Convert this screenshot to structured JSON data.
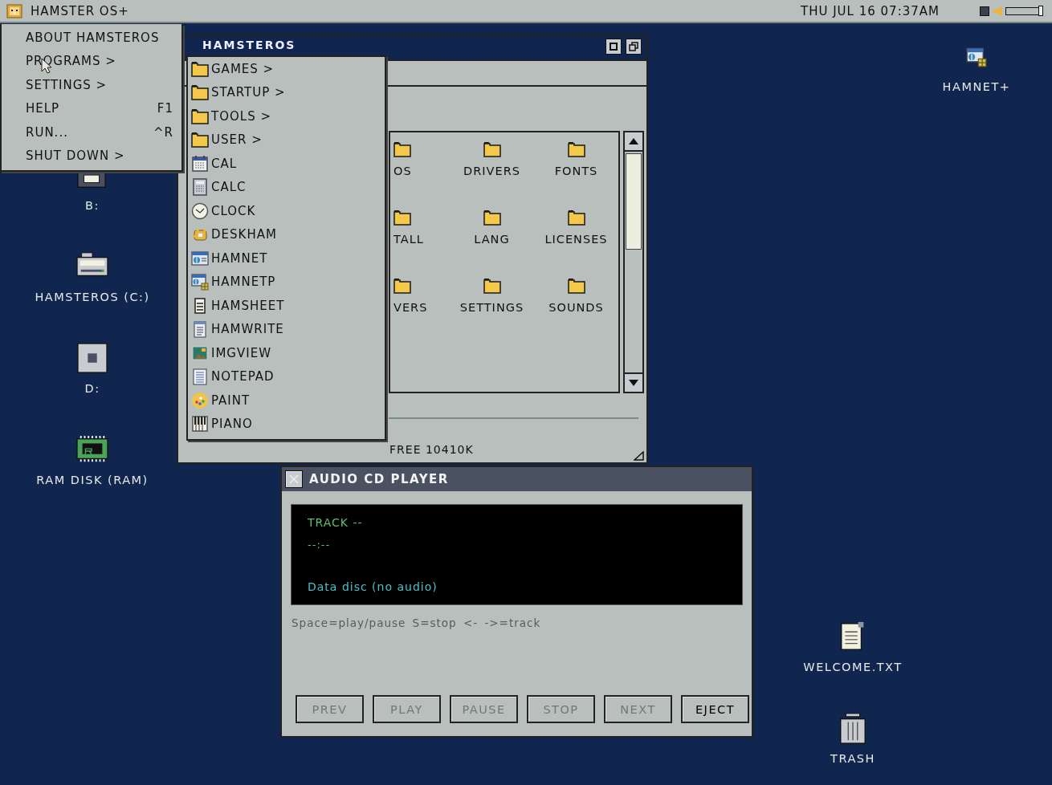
{
  "menubar": {
    "title": "HAMSTER OS+",
    "clock": "THU JUL 16 07:37AM",
    "volume": {
      "level": 0.97
    }
  },
  "start_menu": {
    "items": [
      {
        "label": "ABOUT HAMSTEROS"
      },
      {
        "label": "PROGRAMS >"
      },
      {
        "label": "SETTINGS >"
      },
      {
        "label": "HELP",
        "shortcut": "F1"
      },
      {
        "label": "RUN...",
        "shortcut": "^R"
      },
      {
        "label": "SHUT DOWN >"
      }
    ]
  },
  "programs_menu": {
    "items": [
      {
        "label": "GAMES >",
        "kind": "folder"
      },
      {
        "label": "STARTUP >",
        "kind": "folder"
      },
      {
        "label": "TOOLS >",
        "kind": "folder"
      },
      {
        "label": "USER >",
        "kind": "folder"
      },
      {
        "label": "CAL",
        "kind": "calendar"
      },
      {
        "label": "CALC",
        "kind": "calculator"
      },
      {
        "label": "CLOCK",
        "kind": "clock"
      },
      {
        "label": "DESKHAM",
        "kind": "hamster"
      },
      {
        "label": "HAMNET",
        "kind": "browser"
      },
      {
        "label": "HAMNETP",
        "kind": "browserplus"
      },
      {
        "label": "HAMSHEET",
        "kind": "sheet"
      },
      {
        "label": "HAMWRITE",
        "kind": "document"
      },
      {
        "label": "IMGVIEW",
        "kind": "image"
      },
      {
        "label": "NOTEPAD",
        "kind": "notepad"
      },
      {
        "label": "PAINT",
        "kind": "palette"
      },
      {
        "label": "PIANO",
        "kind": "piano"
      }
    ]
  },
  "explorer_window": {
    "title": "HAMSTEROS",
    "folders": [
      {
        "label": "OS"
      },
      {
        "label": "DRIVERS"
      },
      {
        "label": "FONTS"
      },
      {
        "label": "TALL"
      },
      {
        "label": "LANG"
      },
      {
        "label": "LICENSES"
      },
      {
        "label": "VERS"
      },
      {
        "label": "SETTINGS"
      },
      {
        "label": "SOUNDS"
      }
    ],
    "status": "FREE 10410K"
  },
  "cd_player": {
    "title": "AUDIO CD PLAYER",
    "track": "TRACK --",
    "time": "--:--",
    "message": "Data disc (no audio)",
    "hint": "Space=play/pause S=stop <- ->=track",
    "buttons": [
      {
        "label": "PREV",
        "disabled": true
      },
      {
        "label": "PLAY",
        "disabled": true
      },
      {
        "label": "PAUSE",
        "disabled": true
      },
      {
        "label": "STOP",
        "disabled": true
      },
      {
        "label": "NEXT",
        "disabled": true
      },
      {
        "label": "EJECT",
        "disabled": false
      }
    ]
  },
  "desktop": {
    "left_column": [
      {
        "label": "B:",
        "kind": "floppy"
      },
      {
        "label": "HAMSTEROS (C:)",
        "kind": "harddrive"
      },
      {
        "label": "D:",
        "kind": "drive"
      },
      {
        "label": "RAM DISK (RAM)",
        "kind": "ram"
      }
    ],
    "top_right": [
      {
        "label": "HAMNET+",
        "kind": "browserplus"
      }
    ],
    "bottom_right": [
      {
        "label": "WELCOME.TXT",
        "kind": "textfile"
      },
      {
        "label": "TRASH",
        "kind": "trash"
      }
    ]
  }
}
